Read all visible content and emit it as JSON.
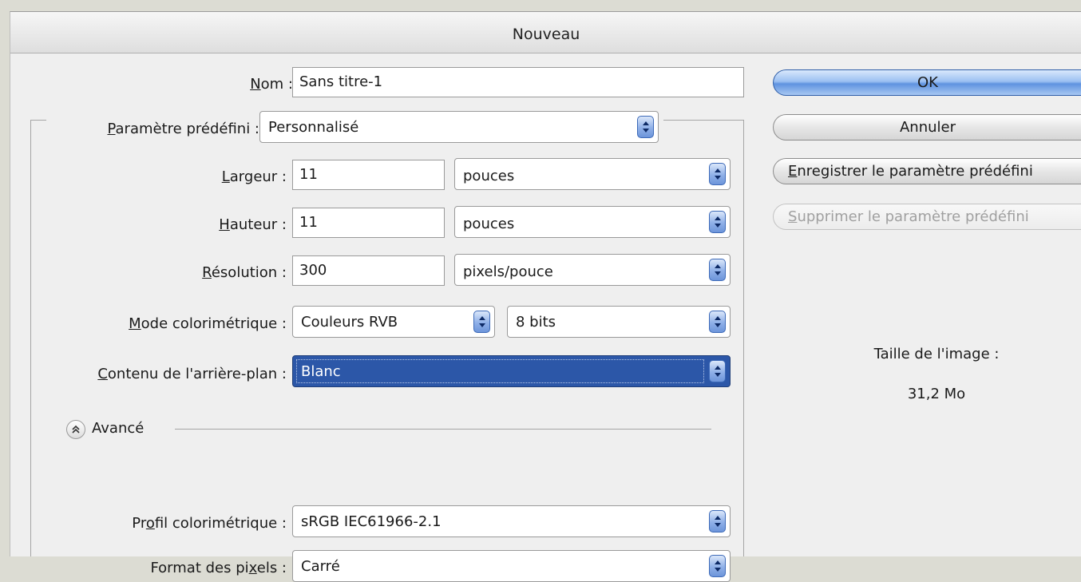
{
  "window": {
    "title": "Nouveau"
  },
  "form": {
    "name": {
      "label_u": "N",
      "label_rest": "om :",
      "value": "Sans titre-1"
    },
    "preset": {
      "label_u": "P",
      "label_rest": "aramètre prédéfini :",
      "value": "Personnalisé"
    },
    "width": {
      "label_u": "L",
      "label_rest": "argeur :",
      "value": "11",
      "unit": "pouces"
    },
    "height": {
      "label_u": "H",
      "label_rest": "auteur :",
      "value": "11",
      "unit": "pouces"
    },
    "resolution": {
      "label_u": "R",
      "label_rest": "ésolution :",
      "value": "300",
      "unit": "pixels/pouce"
    },
    "color_mode": {
      "label_u": "M",
      "label_rest": "ode colorimétrique :",
      "value": "Couleurs RVB",
      "depth": "8 bits"
    },
    "background": {
      "label_u": "C",
      "label_rest": "ontenu de l'arrière-plan :",
      "value": "Blanc"
    }
  },
  "advanced": {
    "label": "Avancé",
    "color_profile": {
      "label_pre": "Pr",
      "label_u": "o",
      "label_rest": "fil colorimétrique :",
      "value": "sRGB IEC61966-2.1"
    },
    "pixel_format": {
      "label_pre": "Format des pi",
      "label_u": "x",
      "label_rest": "els :",
      "value": "Carré"
    }
  },
  "buttons": {
    "ok": "OK",
    "cancel": "Annuler",
    "save_preset_u": "E",
    "save_preset_rest": "nregistrer le paramètre prédéfini",
    "delete_preset_u": "S",
    "delete_preset_rest": "upprimer le paramètre prédéfini"
  },
  "image_size": {
    "label": "Taille de l'image :",
    "value": "31,2 Mo"
  },
  "colors": {
    "selection": "#2c57a8",
    "primary_button": "#5f93e0"
  }
}
